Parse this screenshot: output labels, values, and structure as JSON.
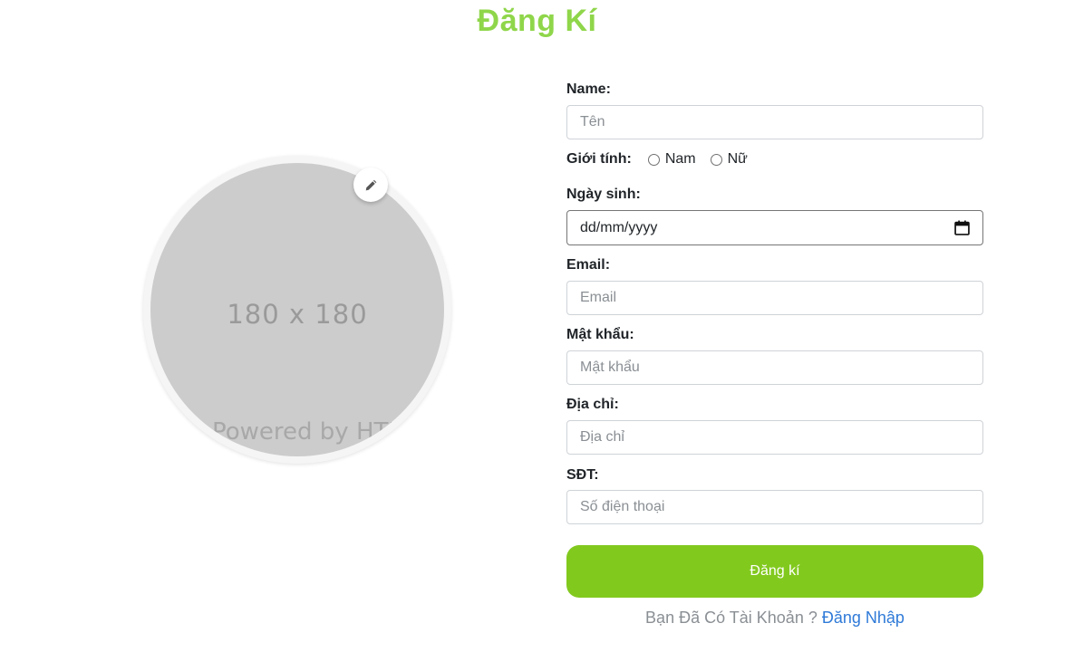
{
  "header": {
    "title": "Đăng Kí"
  },
  "avatar": {
    "size_text": "180 x 180",
    "credit_text": "Powered by HTML Code",
    "edit_icon": "pencil-icon"
  },
  "form": {
    "name": {
      "label": "Name:",
      "placeholder": "Tên"
    },
    "gender": {
      "label": "Giới tính:",
      "options": [
        "Nam",
        "Nữ"
      ]
    },
    "dob": {
      "label": "Ngày sinh:",
      "placeholder": "dd/mm/yyyy",
      "icon": "calendar-icon"
    },
    "email": {
      "label": "Email:",
      "placeholder": "Email"
    },
    "password": {
      "label": "Mật khẩu:",
      "placeholder": "Mật khẩu"
    },
    "address": {
      "label": "Địa chỉ:",
      "placeholder": "Địa chỉ"
    },
    "phone": {
      "label": "SĐT:",
      "placeholder": "Số điện thoại"
    },
    "submit_label": "Đăng kí",
    "login_prompt": "Bạn Đã Có Tài Khoản ?",
    "login_link": "Đăng Nhập"
  },
  "colors": {
    "title": "#8fd64a",
    "submit": "#82c91e",
    "link": "#2f7ad8",
    "avatar_bg": "#cccccc"
  }
}
